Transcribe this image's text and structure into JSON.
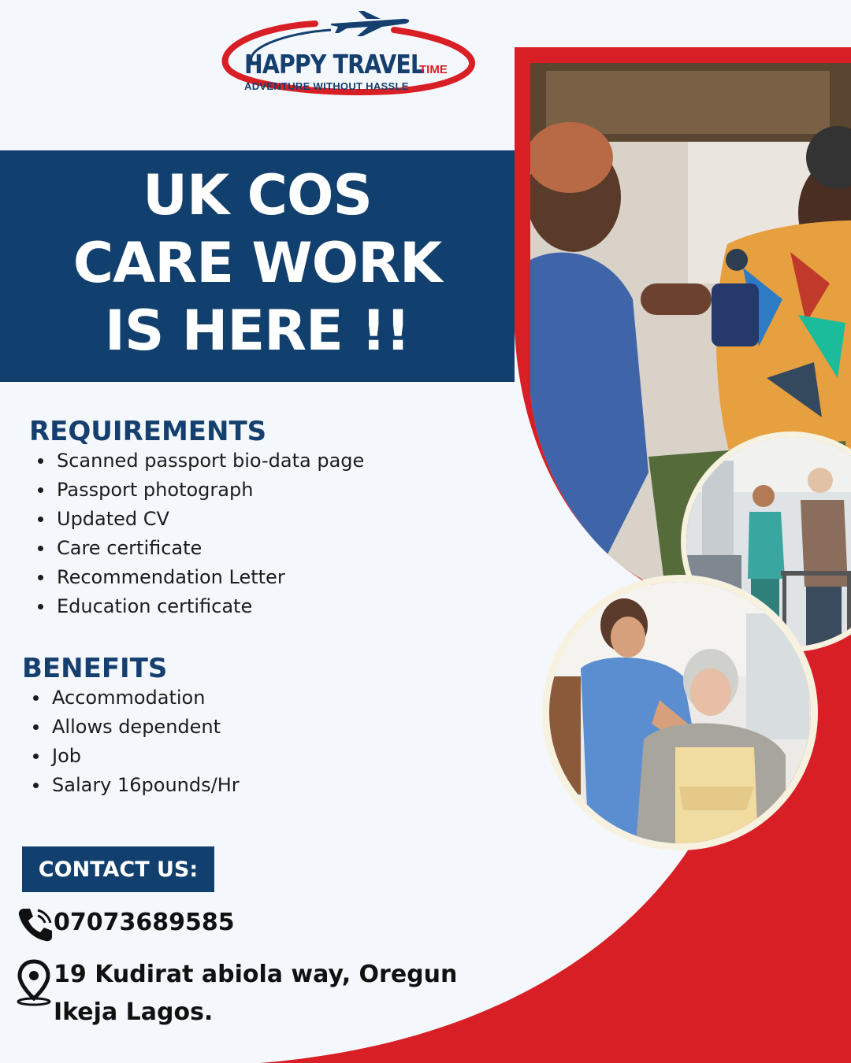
{
  "brand": {
    "name": "HAPPY TRAVEL",
    "suffix": "TIME",
    "tagline": "ADVENTURE WITHOUT HASSLE"
  },
  "headline": {
    "line1": "UK COS",
    "line2": "CARE WORK",
    "line3": "IS HERE !!"
  },
  "requirements": {
    "title": "REQUIREMENTS",
    "items": [
      "Scanned passport bio-data page",
      "Passport photograph",
      "Updated CV",
      "Care certificate",
      "Recommendation Letter",
      "Education certificate"
    ]
  },
  "benefits": {
    "title": "BENEFITS",
    "items": [
      "Accommodation",
      "Allows dependent",
      "Job",
      "Salary 16pounds/Hr"
    ]
  },
  "contact": {
    "title": "CONTACT US:",
    "phone": "07073689585",
    "address_line1": "19 Kudirat abiola way, Oregun",
    "address_line2": "Ikeja Lagos."
  },
  "colors": {
    "navy": "#11406e",
    "red": "#d81f26",
    "background": "#f4f8fc"
  },
  "icons": [
    "phone-icon",
    "location-pin-icon",
    "airplane-icon"
  ]
}
